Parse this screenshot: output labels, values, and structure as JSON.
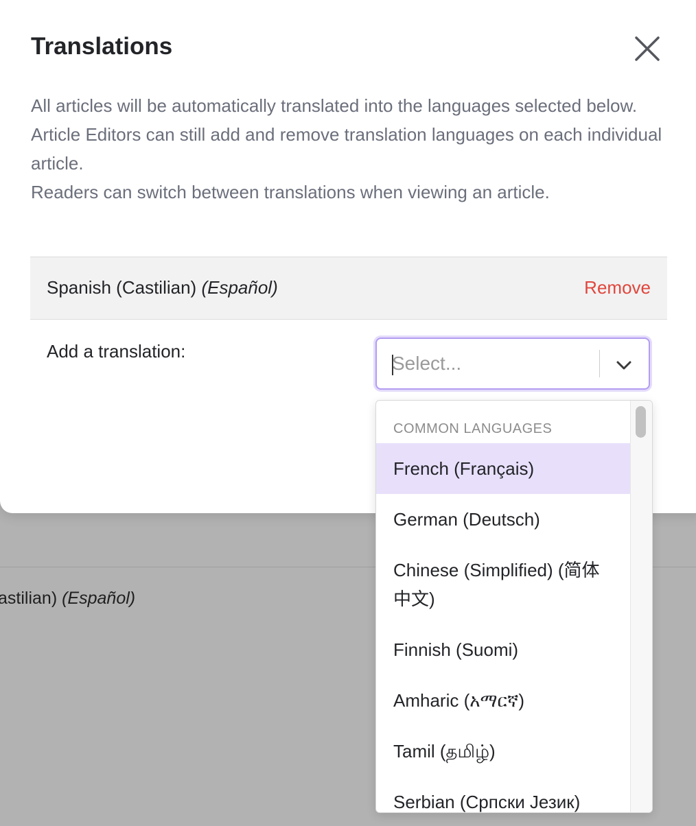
{
  "background": {
    "row": {
      "name": "astilian)",
      "native": "(Español)"
    }
  },
  "modal": {
    "title": "Translations",
    "description": [
      "All articles will be automatically translated into the languages selected below.",
      "Article Editors can still add and remove translation languages on each individual article.",
      "Readers can switch between translations when viewing an article."
    ],
    "selected_language": {
      "name": "Spanish (Castilian)",
      "native": "(Español)",
      "remove_label": "Remove"
    },
    "add_label": "Add a translation:",
    "select": {
      "placeholder": "Select..."
    },
    "dropdown": {
      "group_heading": "Common Languages",
      "options": [
        "French (Français)",
        "German (Deutsch)",
        "Chinese (Simplified) (简体中文)",
        "Finnish (Suomi)",
        "Amharic (አማርኛ)",
        "Tamil (தமிழ்)",
        "Serbian (Српски Језик)"
      ]
    }
  },
  "colors": {
    "accent": "#9d6bf0",
    "focus_border": "#b39cf2",
    "option_highlight": "#e8e0fb",
    "remove": "#e0463d",
    "overlay": "#b2b2b2"
  },
  "icons": {
    "close": "close-icon",
    "dropdown": "chevron-down-icon"
  }
}
